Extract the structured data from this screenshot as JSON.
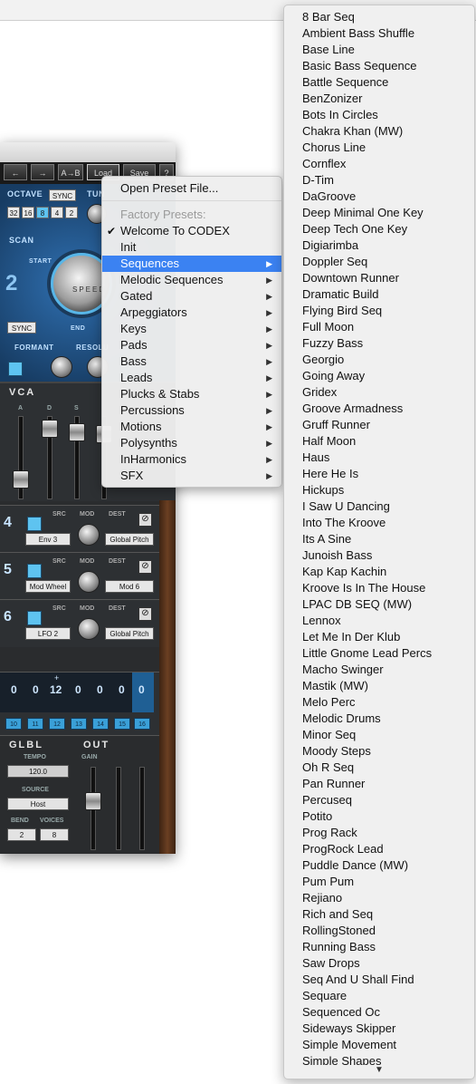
{
  "toolbar": {
    "back": "←",
    "forward": "→",
    "ab": "A→B",
    "load": "Load",
    "save": "Save",
    "help": "?"
  },
  "synth": {
    "octave_label": "OCTAVE",
    "sync_label": "SYNC",
    "tune_label": "TUN",
    "octaves": [
      "32",
      "16",
      "8",
      "4",
      "2"
    ],
    "scan_label": "SCAN",
    "start_label": "START",
    "speed_label": "SPEED",
    "end_label": "END",
    "osc_number": "2",
    "sync2_label": "SYNC",
    "formant_label": "FORMANT",
    "resolution_label": "RESOLU",
    "vca_label": "VCA",
    "adsr": [
      "A",
      "D",
      "S"
    ],
    "mod_rows": [
      {
        "num": "4",
        "src_label": "SRC",
        "mod_label": "MOD",
        "dest_label": "DEST",
        "src": "Env 3",
        "dest": "Global Pitch"
      },
      {
        "num": "5",
        "src_label": "SRC",
        "mod_label": "MOD",
        "dest_label": "DEST",
        "src": "Mod Wheel",
        "dest": "Mod 6"
      },
      {
        "num": "6",
        "src_label": "SRC",
        "mod_label": "MOD",
        "dest_label": "DEST",
        "src": "LFO 2",
        "dest": "Global Pitch"
      }
    ],
    "seq_values": [
      "0",
      "0",
      "12",
      "0",
      "0",
      "0",
      "0"
    ],
    "seq_plus": "+",
    "seq_numbers": [
      "10",
      "11",
      "12",
      "13",
      "14",
      "15",
      "16"
    ],
    "glbl_title": "GLBL",
    "out_title": "OUT",
    "tempo_label": "TEMPO",
    "tempo_value": "120.0",
    "source_label": "SOURCE",
    "source_value": "Host",
    "bend_label": "BEND",
    "voices_label": "VOICES",
    "bend_value": "2",
    "voices_value": "8",
    "gain_label": "GAIN"
  },
  "context_menu": {
    "open_preset": "Open Preset File...",
    "factory_header": "Factory Presets:",
    "checked": "Welcome To CODEX",
    "items": [
      {
        "label": "Init",
        "submenu": false
      },
      {
        "label": "Sequences",
        "submenu": true,
        "selected": true
      },
      {
        "label": "Melodic Sequences",
        "submenu": true
      },
      {
        "label": "Gated",
        "submenu": true
      },
      {
        "label": "Arpeggiators",
        "submenu": true
      },
      {
        "label": "Keys",
        "submenu": true
      },
      {
        "label": "Pads",
        "submenu": true
      },
      {
        "label": "Bass",
        "submenu": true
      },
      {
        "label": "Leads",
        "submenu": true
      },
      {
        "label": "Plucks & Stabs",
        "submenu": true
      },
      {
        "label": "Percussions",
        "submenu": true
      },
      {
        "label": "Motions",
        "submenu": true
      },
      {
        "label": "Polysynths",
        "submenu": true
      },
      {
        "label": "InHarmonics",
        "submenu": true
      },
      {
        "label": "SFX",
        "submenu": true
      }
    ]
  },
  "sequences_menu": {
    "items": [
      "8 Bar Seq",
      "Ambient Bass Shuffle",
      "Base Line",
      "Basic Bass Sequence",
      "Battle Sequence",
      "BenZonizer",
      "Bots In Circles",
      "Chakra Khan (MW)",
      "Chorus Line",
      "Cornflex",
      "D-Tim",
      "DaGroove",
      "Deep Minimal One Key",
      "Deep Tech One Key",
      "Digiarimba",
      "Doppler Seq",
      "Downtown Runner",
      "Dramatic Build",
      "Flying Bird Seq",
      "Full Moon",
      "Fuzzy Bass",
      "Georgio",
      "Going Away",
      "Gridex",
      "Groove Armadness",
      "Gruff Runner",
      "Half Moon",
      "Haus",
      "Here He Is",
      "Hickups",
      "I Saw U Dancing",
      "Into The Kroove",
      "Its A Sine",
      "Junoish Bass",
      "Kap Kap Kachin",
      "Kroove Is In The House",
      "LPAC DB SEQ (MW)",
      "Lennox",
      "Let Me In Der Klub",
      "Little Gnome Lead Percs",
      "Macho Swinger",
      "Mastik (MW)",
      "Melo Perc",
      "Melodic Drums",
      "Minor Seq",
      "Moody Steps",
      "Oh R Seq",
      "Pan Runner",
      "Percuseq",
      "Potito",
      "Prog Rack",
      "ProgRock Lead",
      "Puddle Dance (MW)",
      "Pum Pum",
      "Rejiano",
      "Rich and Seq",
      "RollingStoned",
      "Running Bass",
      "Saw Drops",
      "Seq And U Shall Find",
      "Sequare",
      "Sequenced Oc",
      "Sideways Skipper",
      "Simple Movement",
      "Simple Shapes"
    ],
    "scroll_down": "▼"
  }
}
